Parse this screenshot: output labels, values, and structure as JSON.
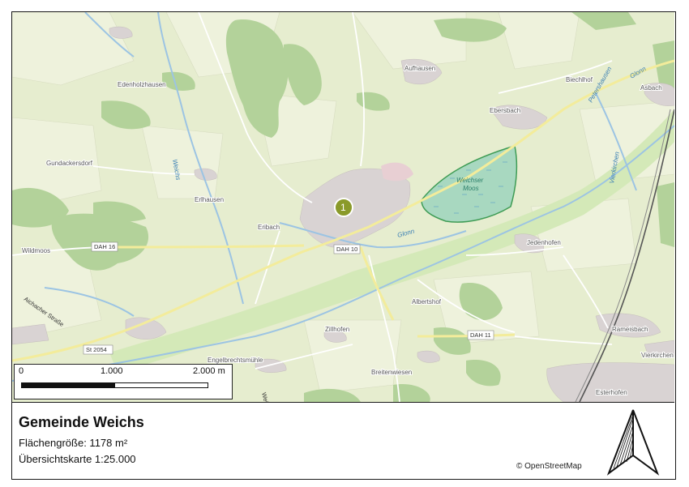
{
  "map": {
    "marker": {
      "label": "1",
      "color": "#8a9a2a"
    },
    "places": [
      "Aufhausen",
      "Biechlhof",
      "Asbach",
      "Edenholzhausen",
      "Ebersbach",
      "Gundackersdorf",
      "Erlhausen",
      "Eribach",
      "Wildmoos",
      "Jedenhofen",
      "Albertshof",
      "Zillhofen",
      "Engelbrechtsmühle",
      "Breitenwiesen",
      "Rameisbach",
      "Vierkirchen",
      "Esterhofen"
    ],
    "rivers": [
      "Glonn",
      "Glonn",
      "Weichs",
      "Petershausen",
      "Vierkirchen"
    ],
    "moos_label": [
      "Weichser",
      "Moos"
    ],
    "roads": [
      "DAH 16",
      "DAH 10",
      "DAH 11",
      "St 2054",
      "Aichacher Straße",
      "Weichs"
    ]
  },
  "scalebar": {
    "left": "0",
    "mid": "1.000",
    "right": "2.000 m"
  },
  "legend": {
    "title": "Gemeinde Weichs",
    "area": "Flächengröße: 1178 m²",
    "scale": "Übersichtskarte 1:25.000"
  },
  "attribution": "© OpenStreetMap",
  "north_arrow": {
    "icon": "north-arrow-icon"
  }
}
